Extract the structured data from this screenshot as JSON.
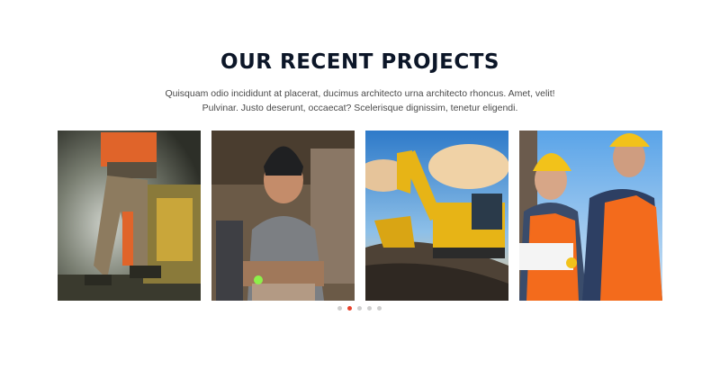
{
  "section": {
    "title": "OUR RECENT PROJECTS",
    "description": "Quisquam odio incididunt at placerat, ducimus architecto urna architecto rhoncus. Amet, velit! Pulvinar. Justo deserunt, occaecat? Scelerisque dignissim, tenetur eligendi."
  },
  "projects": [
    {
      "image": "worker-cutting-with-saw-photo"
    },
    {
      "image": "welder-with-helmet-photo"
    },
    {
      "image": "yellow-excavator-photo"
    },
    {
      "image": "engineers-with-hardhats-photo"
    }
  ],
  "carousel": {
    "dot_count": 5,
    "active_dot": 2
  },
  "colors": {
    "title": "#0c1628",
    "text": "#4a4a4a",
    "accent": "#e8412b",
    "dot_inactive": "#cfcfcf"
  }
}
